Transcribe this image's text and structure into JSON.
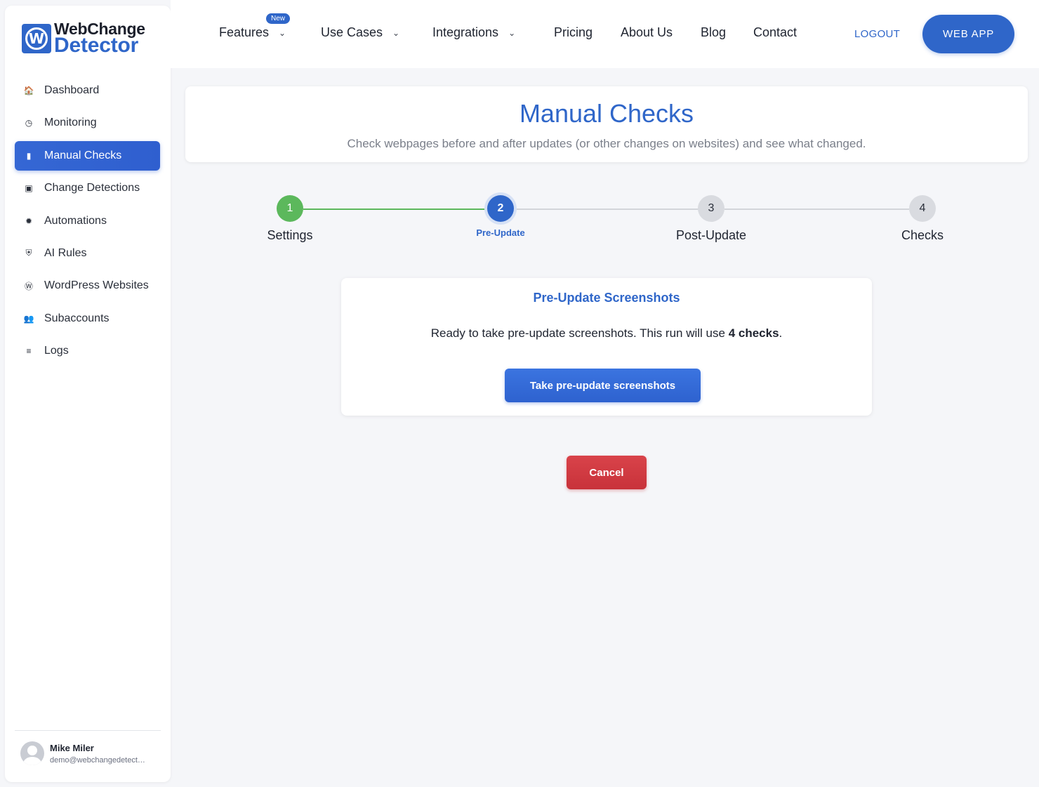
{
  "brand": {
    "line1": "WebChange",
    "line2": "Detector",
    "mark": "W"
  },
  "sidebar": {
    "items": [
      {
        "label": "Dashboard",
        "icon": "home-icon",
        "glyph": "🏠",
        "active": false
      },
      {
        "label": "Monitoring",
        "icon": "clock-icon",
        "glyph": "◷",
        "active": false
      },
      {
        "label": "Manual Checks",
        "icon": "clipboard-icon",
        "glyph": "▮",
        "active": true
      },
      {
        "label": "Change Detections",
        "icon": "monitor-icon",
        "glyph": "▣",
        "active": false
      },
      {
        "label": "Automations",
        "icon": "gear-icon",
        "glyph": "✹",
        "active": false
      },
      {
        "label": "AI Rules",
        "icon": "shield-icon",
        "glyph": "⛨",
        "active": false
      },
      {
        "label": "WordPress Websites",
        "icon": "wordpress-icon",
        "glyph": "Ⓦ",
        "active": false
      },
      {
        "label": "Subaccounts",
        "icon": "users-icon",
        "glyph": "👥",
        "active": false
      },
      {
        "label": "Logs",
        "icon": "list-icon",
        "glyph": "≡",
        "active": false
      }
    ],
    "user": {
      "name": "Mike Miler",
      "email": "demo@webchangedetect…"
    }
  },
  "topnav": {
    "items": [
      {
        "label": "Features",
        "dropdown": true,
        "badge": "New"
      },
      {
        "label": "Use Cases",
        "dropdown": true
      },
      {
        "label": "Integrations",
        "dropdown": true
      },
      {
        "label": "Pricing",
        "dropdown": false
      },
      {
        "label": "About Us",
        "dropdown": false
      },
      {
        "label": "Blog",
        "dropdown": false
      },
      {
        "label": "Contact",
        "dropdown": false
      }
    ],
    "logout": "LOGOUT",
    "webapp": "WEB APP"
  },
  "header": {
    "title": "Manual Checks",
    "subtitle": "Check webpages before and after updates (or other changes on websites) and see what changed."
  },
  "stepper": {
    "current": 2,
    "steps": [
      {
        "number": "1",
        "label": "Settings",
        "state": "done"
      },
      {
        "number": "2",
        "label": "Pre-Update",
        "state": "active"
      },
      {
        "number": "3",
        "label": "Post-Update",
        "state": "pending"
      },
      {
        "number": "4",
        "label": "Checks",
        "state": "pending"
      }
    ]
  },
  "card": {
    "title": "Pre-Update Screenshots",
    "message_prefix": "Ready to take pre-update screenshots. This run will use ",
    "message_bold": "4 checks",
    "message_suffix": ".",
    "button": "Take pre-update screenshots"
  },
  "cancel": "Cancel",
  "colors": {
    "primary": "#2f66c9",
    "success": "#5cb85c",
    "danger": "#cc3a41",
    "pending": "#d9dbe0"
  }
}
